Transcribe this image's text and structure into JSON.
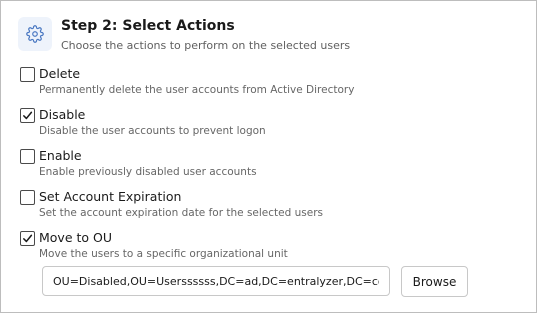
{
  "step": {
    "icon": "gear-icon",
    "title": "Step 2: Select Actions",
    "subtitle": "Choose the actions to perform on the selected users"
  },
  "options": [
    {
      "label": "Delete",
      "description": "Permanently delete the user accounts from Active Directory",
      "checked": false
    },
    {
      "label": "Disable",
      "description": "Disable the user accounts to prevent logon",
      "checked": true
    },
    {
      "label": "Enable",
      "description": "Enable previously disabled user accounts",
      "checked": false
    },
    {
      "label": "Set Account Expiration",
      "description": "Set the account expiration date for the selected users",
      "checked": false
    },
    {
      "label": "Move to OU",
      "description": "Move the users to a specific organizational unit",
      "checked": true
    }
  ],
  "move_to_ou": {
    "value": "OU=Disabled,OU=Userssssss,DC=ad,DC=entralyzer,DC=com",
    "browse_label": "Browse"
  },
  "colors": {
    "icon_bg": "#eef3fb",
    "icon_stroke": "#4a78c2",
    "border": "#bdbdbd"
  }
}
